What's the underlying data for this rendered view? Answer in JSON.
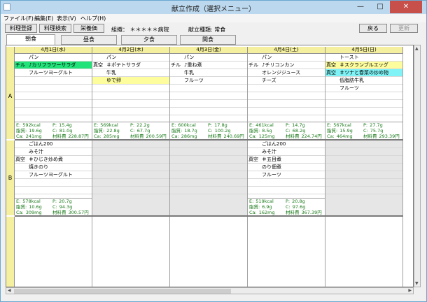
{
  "window": {
    "title": "献立作成（選択メニュー）",
    "controls": [
      "—",
      "□",
      "✕"
    ]
  },
  "menu": [
    "ファイル(F)",
    "編集(E)",
    "表示(V)",
    "ヘルプ(H)"
  ],
  "toolbar": {
    "buttons": [
      "料理登録",
      "料理検索",
      "栄養価"
    ],
    "org": "組織： ＊＊＊＊＊病院",
    "menu_type": "献立種類: 常食",
    "back": "戻る",
    "update": "更新"
  },
  "tabs": [
    "朝食",
    "昼食",
    "夕食",
    "間食"
  ],
  "active_tab": 0,
  "days": [
    "4月1日(水)",
    "4月2日(木)",
    "4月3日(金)",
    "4月4日(土)",
    "4月5日(日)"
  ],
  "sections": [
    {
      "label": "A",
      "cells": [
        {
          "items": [
            [
              "",
              "パン",
              ""
            ],
            [
              "チル",
              "♪カリフラワーサラダ",
              "green"
            ],
            [
              "",
              "フルーツヨーグルト",
              ""
            ]
          ],
          "nut": [
            [
              "E:",
              "592kcal",
              "P:",
              "15.4g"
            ],
            [
              "脂質:",
              "19.6g",
              "C:",
              "81.0g"
            ],
            [
              "Ca:",
              "241mg",
              "材料費",
              "228.87円"
            ]
          ]
        },
        {
          "items": [
            [
              "",
              "パン",
              ""
            ],
            [
              "真空",
              "＃ポテトサラダ",
              ""
            ],
            [
              "",
              "牛乳",
              ""
            ],
            [
              "",
              "ゆで卵",
              "yellow"
            ]
          ],
          "nut": [
            [
              "E:",
              "569kcal",
              "P:",
              "22.2g"
            ],
            [
              "脂質:",
              "22.8g",
              "C:",
              "67.7g"
            ],
            [
              "Ca:",
              "285mg",
              "材料費",
              "200.59円"
            ]
          ]
        },
        {
          "items": [
            [
              "",
              "パン",
              ""
            ],
            [
              "チル",
              "♪重ね煮",
              ""
            ],
            [
              "",
              "牛乳",
              ""
            ],
            [
              "",
              "フルーツ",
              ""
            ]
          ],
          "nut": [
            [
              "E:",
              "600kcal",
              "P:",
              "17.8g"
            ],
            [
              "脂質:",
              "18.7g",
              "C:",
              "100.2g"
            ],
            [
              "Ca:",
              "286mg",
              "材料費",
              "240.69円"
            ]
          ]
        },
        {
          "items": [
            [
              "",
              "パン",
              ""
            ],
            [
              "チル",
              "♪チリコンカン",
              ""
            ],
            [
              "",
              "オレンジジュース",
              ""
            ],
            [
              "",
              "チーズ",
              ""
            ]
          ],
          "nut": [
            [
              "E:",
              "461kcal",
              "P:",
              "14.7g"
            ],
            [
              "脂質:",
              "8.5g",
              "C:",
              "68.2g"
            ],
            [
              "Ca:",
              "125mg",
              "材料費",
              "224.74円"
            ]
          ]
        },
        {
          "items": [
            [
              "",
              "トースト",
              ""
            ],
            [
              "真空",
              "＃スクランブルエッグ",
              "yellow"
            ],
            [
              "真空",
              "＃ツナと春菜の炒め物",
              "cyan"
            ],
            [
              "",
              "低脂肪牛乳",
              ""
            ],
            [
              "",
              "フルーツ",
              ""
            ]
          ],
          "nut": [
            [
              "E:",
              "567kcal",
              "P:",
              "27.7g"
            ],
            [
              "脂質:",
              "15.9g",
              "C:",
              "75.7g"
            ],
            [
              "Ca:",
              "464mg",
              "材料費",
              "293.39円"
            ]
          ]
        }
      ]
    },
    {
      "label": "B",
      "cells": [
        {
          "items": [
            [
              "",
              "ごはん200",
              ""
            ],
            [
              "",
              "みそ汁",
              ""
            ],
            [
              "真空",
              "＃ひじき炒め煮",
              ""
            ],
            [
              "",
              "焼きのり",
              ""
            ],
            [
              "",
              "フルーツヨーグルト",
              ""
            ]
          ],
          "nut": [
            [
              "E:",
              "578kcal",
              "P:",
              "20.7g"
            ],
            [
              "脂質:",
              "10.6g",
              "C:",
              "94.3g"
            ],
            [
              "Ca:",
              "309mg",
              "材料費",
              "300.57円"
            ]
          ]
        },
        {
          "items": [],
          "nut": []
        },
        {
          "items": [],
          "nut": []
        },
        {
          "items": [
            [
              "",
              "ごはん200",
              ""
            ],
            [
              "",
              "みそ汁",
              ""
            ],
            [
              "真空",
              "＃五目煮",
              ""
            ],
            [
              "",
              "のり佃煮",
              ""
            ],
            [
              "",
              "フルーツ",
              ""
            ]
          ],
          "nut": [
            [
              "E:",
              "519kcal",
              "P:",
              "20.8g"
            ],
            [
              "脂質:",
              "6.9g",
              "C:",
              "97.6g"
            ],
            [
              "Ca:",
              "162mg",
              "材料費",
              "367.39円"
            ]
          ]
        },
        {
          "items": [],
          "nut": []
        }
      ]
    }
  ]
}
